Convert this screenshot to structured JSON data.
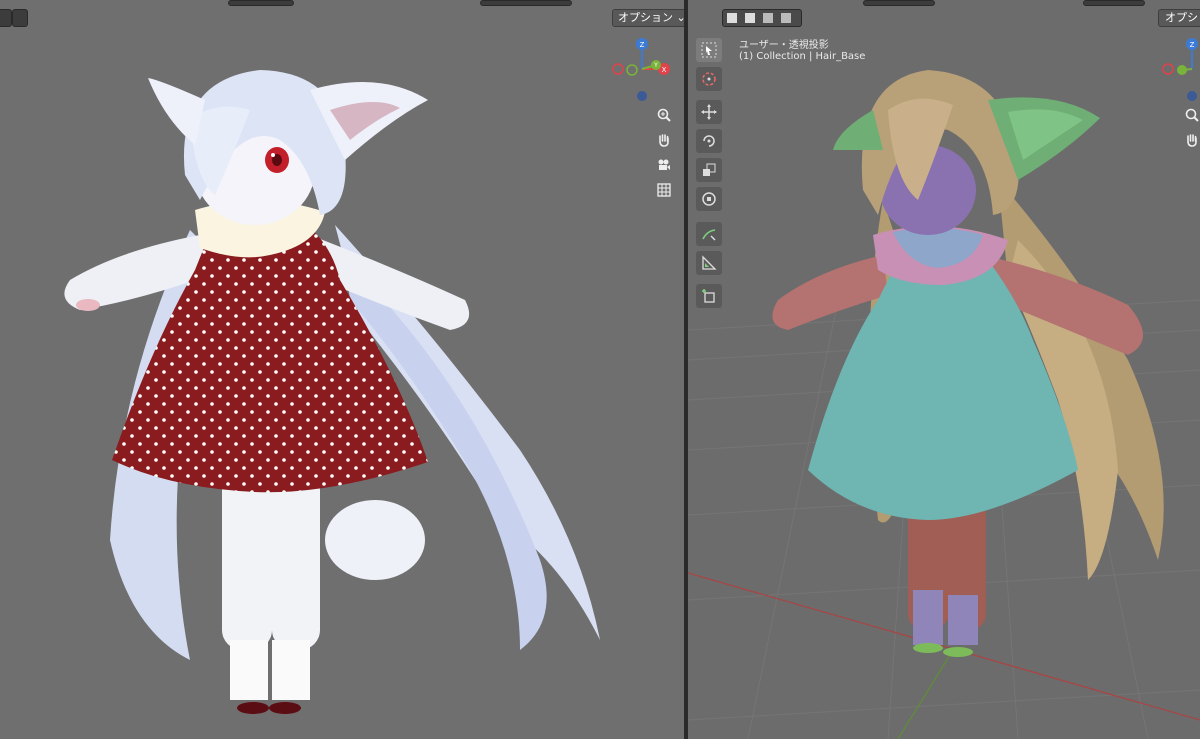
{
  "left_viewport": {
    "options_label": "オプション ⌄",
    "gizmo": {
      "z": "Z",
      "x": "X",
      "y": "Y"
    },
    "nav_icons": [
      "zoom-icon",
      "hand-pan-icon",
      "camera-icon",
      "grid-icon"
    ],
    "model": "white-haired cat-eared girl in red polka-dot dress"
  },
  "right_viewport": {
    "options_label": "オプシ",
    "view_label": "ユーザー・透視投影",
    "collection_label": "(1) Collection | Hair_Base",
    "tools": [
      "select-box-icon",
      "cursor-icon",
      "move-icon",
      "rotate-icon",
      "scale-icon",
      "transform-icon",
      "annotate-icon",
      "measure-icon",
      "add-cube-icon"
    ],
    "gizmo": {
      "z": "Z",
      "x": "X",
      "y": "Y"
    },
    "nav_icons": [
      "zoom-icon",
      "hand-pan-icon"
    ],
    "model": "colored-material preview of the same character"
  },
  "colors": {
    "viewport_bg": "#6f6f6f",
    "axis_x": "#e2424a",
    "axis_y": "#7ab33a",
    "axis_z": "#3b7bd6",
    "dress_left": "#8a1b1e",
    "dress_right": "#6fb5b1",
    "hair_left": "#dfe6f7",
    "hair_right": "#b8a078"
  }
}
